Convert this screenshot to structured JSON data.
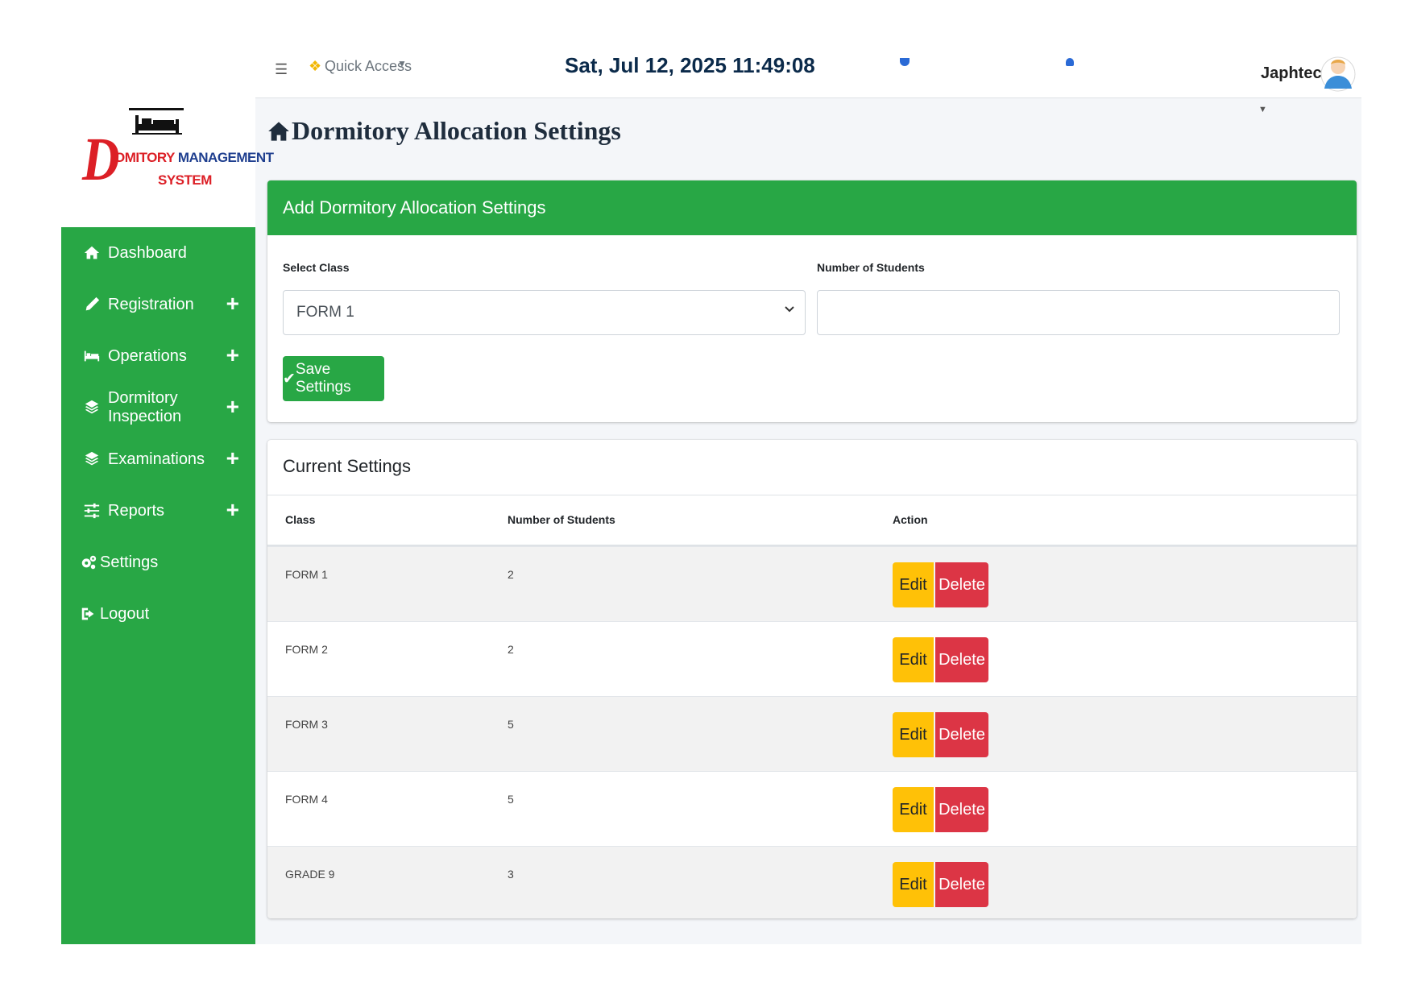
{
  "brand": {
    "big_letter": "D",
    "line1_a": "OMITORY",
    "line1_b": "MANAGEMENT",
    "line2": "SYSTEM"
  },
  "topbar": {
    "quick_access": "Quick Access",
    "datetime": "Sat, Jul 12, 2025 11:49:08",
    "username": "Japhtech"
  },
  "sidebar": {
    "items": [
      {
        "label": "Dashboard",
        "icon": "home-icon"
      },
      {
        "label": "Registration",
        "icon": "pencil-icon"
      },
      {
        "label": "Operations",
        "icon": "bed-icon"
      },
      {
        "label": "Dormitory Inspection",
        "icon": "layers-icon"
      },
      {
        "label": "Examinations",
        "icon": "layers-icon"
      },
      {
        "label": "Reports",
        "icon": "sliders-icon"
      },
      {
        "label": "Settings",
        "icon": "gears-icon"
      },
      {
        "label": "Logout",
        "icon": "sign-out-icon"
      }
    ],
    "expand_symbol": "+"
  },
  "page": {
    "title": "Dormitory Allocation Settings"
  },
  "form": {
    "header": "Add Dormitory Allocation Settings",
    "class_label": "Select Class",
    "class_value": "FORM 1",
    "students_label": "Number of Students",
    "students_value": "",
    "save_label": "Save Settings"
  },
  "table": {
    "title": "Current Settings",
    "headers": [
      "Class",
      "Number of Students",
      "Action"
    ],
    "edit_label": "Edit",
    "delete_label": "Delete",
    "rows": [
      {
        "class": "FORM 1",
        "students": "2"
      },
      {
        "class": "FORM 2",
        "students": "2"
      },
      {
        "class": "FORM 3",
        "students": "5"
      },
      {
        "class": "FORM 4",
        "students": "5"
      },
      {
        "class": "GRADE 9",
        "students": "3"
      }
    ]
  },
  "colors": {
    "primary_green": "#28a745",
    "edit_yellow": "#ffc107",
    "delete_red": "#dc3545",
    "brand_red": "#dc1f26",
    "brand_blue": "#1f3f8f"
  }
}
